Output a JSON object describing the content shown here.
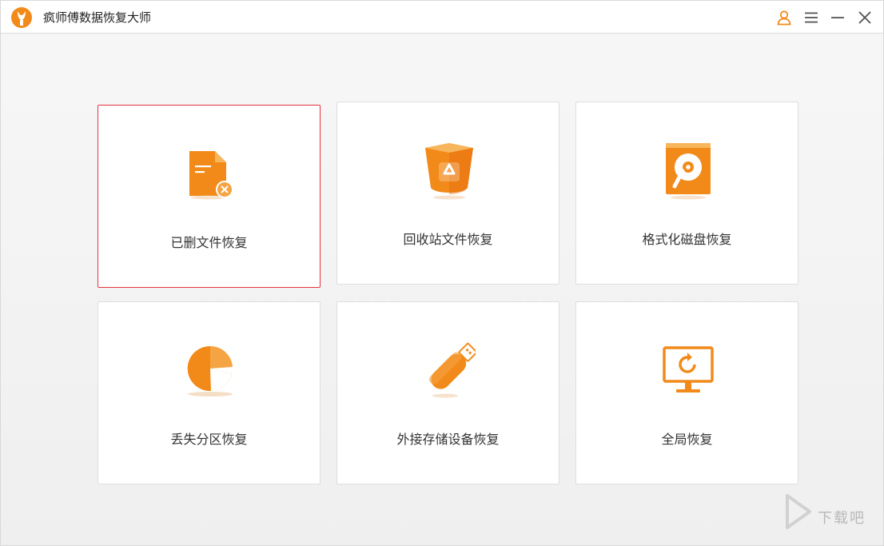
{
  "window": {
    "title": "疯师傅数据恢复大师"
  },
  "colors": {
    "accent": "#f28a1a",
    "accent_dark": "#e56a0c",
    "selected_border": "#e5333f"
  },
  "titlebar": {
    "icons": [
      "user-icon",
      "menu-icon",
      "minimize-icon",
      "close-icon"
    ]
  },
  "options": [
    {
      "label": "已删文件恢复",
      "icon": "deleted-file-icon",
      "selected": true
    },
    {
      "label": "回收站文件恢复",
      "icon": "recycle-bin-icon",
      "selected": false
    },
    {
      "label": "格式化磁盘恢复",
      "icon": "formatted-disk-icon",
      "selected": false
    },
    {
      "label": "丢失分区恢复",
      "icon": "partition-pie-icon",
      "selected": false
    },
    {
      "label": "外接存储设备恢复",
      "icon": "usb-drive-icon",
      "selected": false
    },
    {
      "label": "全局恢复",
      "icon": "monitor-restore-icon",
      "selected": false
    }
  ],
  "watermark": {
    "text": "下载吧"
  }
}
